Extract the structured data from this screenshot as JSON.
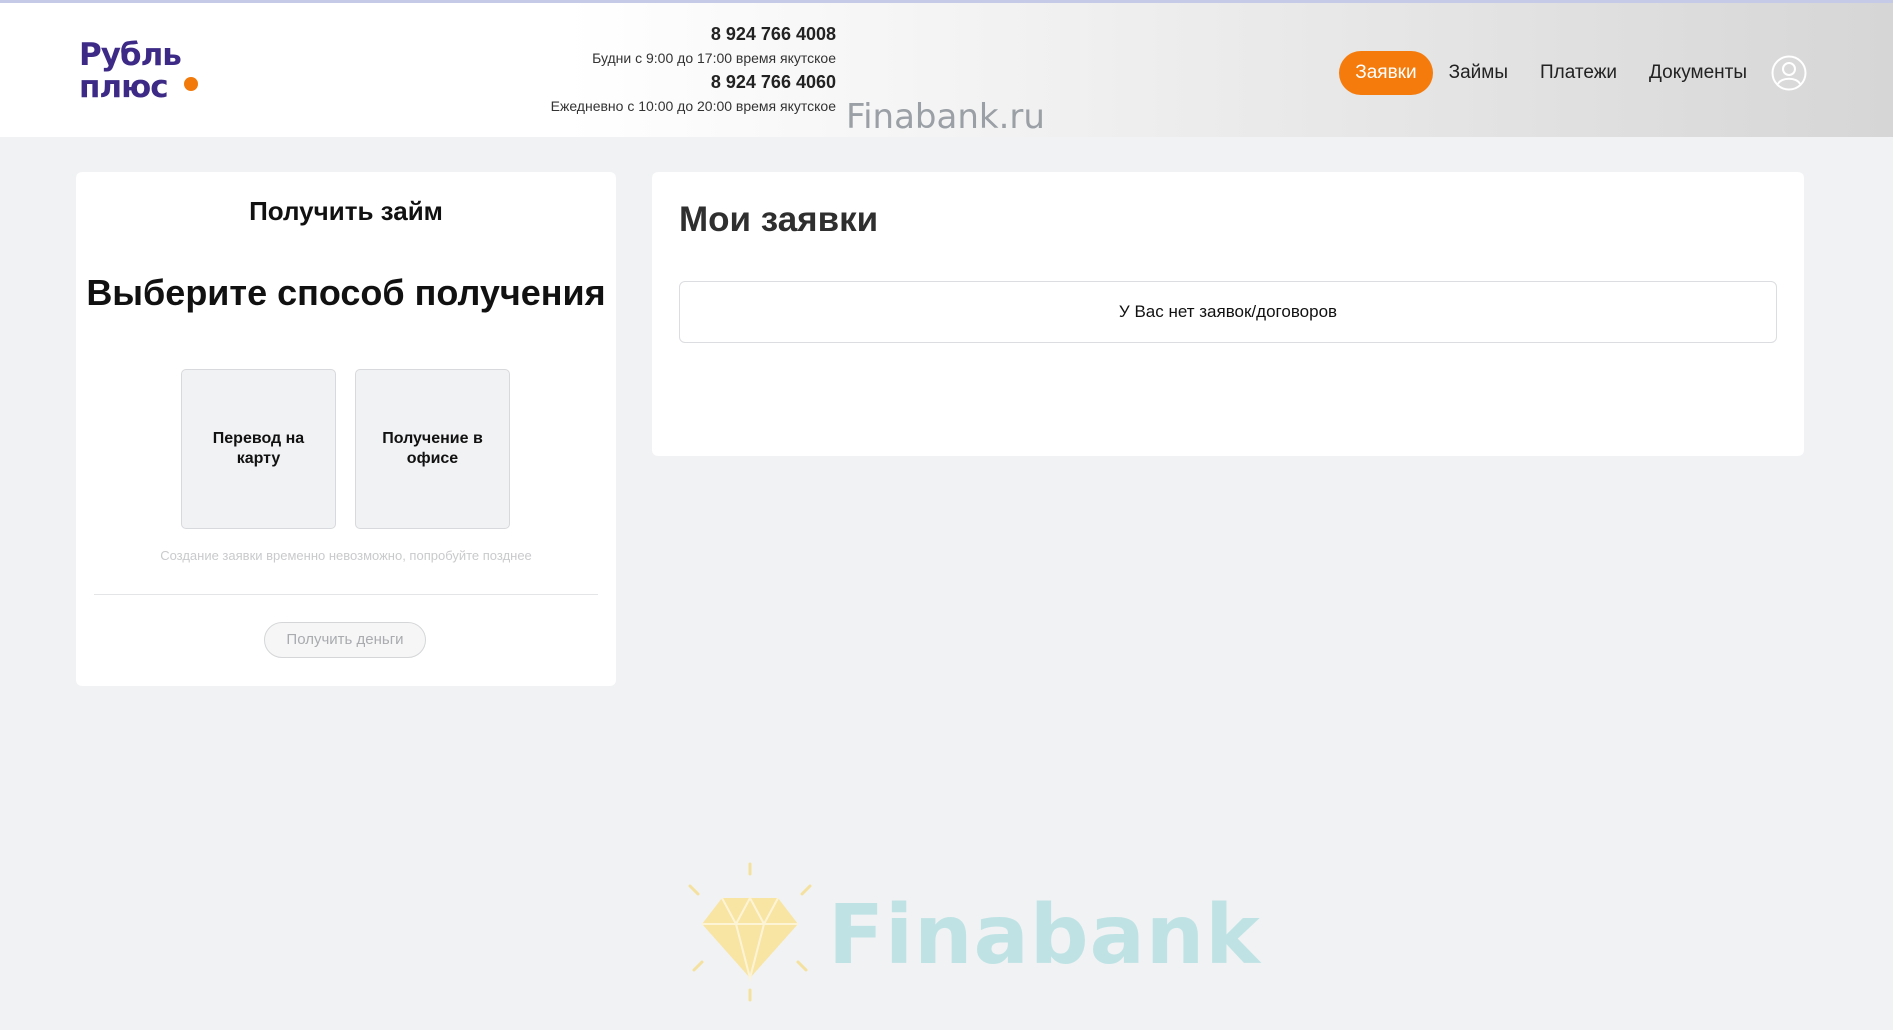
{
  "header": {
    "logo": {
      "line1": "Рубль",
      "line2": "плюс"
    },
    "contacts": [
      {
        "phone": "8 924 766 4008",
        "hours": "Будни с 9:00 до 17:00 время якутское"
      },
      {
        "phone": "8 924 766 4060",
        "hours": "Ежедневно с 10:00 до 20:00 время якутское"
      }
    ],
    "watermark": "Finabank.ru",
    "nav": [
      {
        "label": "Заявки",
        "active": true
      },
      {
        "label": "Займы"
      },
      {
        "label": "Платежи"
      },
      {
        "label": "Документы"
      }
    ],
    "account_icon": "user-circle-icon"
  },
  "get_loan": {
    "title": "Получить займ",
    "heading": "Выберите способ получения",
    "options": [
      {
        "label": "Перевод на карту"
      },
      {
        "label": "Получение в офисе"
      }
    ],
    "notice": "Создание заявки временно невозможно, попробуйте позднее",
    "button": "Получить деньги"
  },
  "applications": {
    "title": "Мои заявки",
    "empty_text": "У Вас нет заявок/договоров"
  },
  "brand_watermark": {
    "name": "Finabank",
    "icon": "diamond-icon"
  },
  "colors": {
    "accent": "#f47b0c",
    "logo": "#3c2a86",
    "background": "#f1f2f4"
  }
}
